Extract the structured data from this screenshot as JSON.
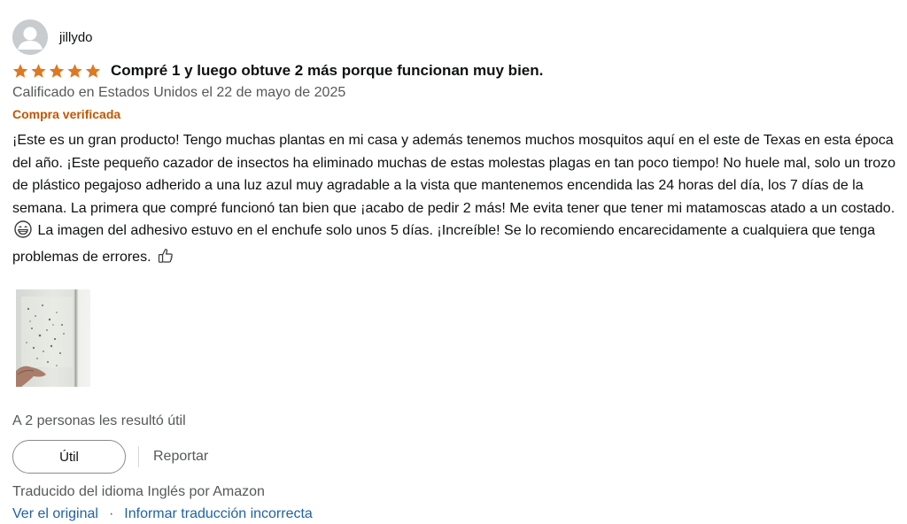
{
  "profile": {
    "name": "jillydo"
  },
  "review": {
    "rating": 5,
    "rating_max": 5,
    "title": "Compré 1 y luego obtuve 2 más porque funcionan muy bien.",
    "date": "Calificado en Estados Unidos el 22 de mayo de 2025",
    "verified": "Compra verificada",
    "body_part1": "¡Este es un gran producto! Tengo muchas plantas en mi casa y además tenemos muchos mosquitos aquí en el este de Texas en esta época del año. ¡Este pequeño cazador de insectos ha eliminado muchas de estas molestas plagas en tan poco tiempo! No huele mal, solo un trozo de plástico pegajoso adherido a una luz azul muy agradable a la vista que mantenemos encendida las 24 horas del día, los 7 días de la semana. La primera que compré funcionó tan bien que ¡acabo de pedir 2 más! Me evita tener que tener mi matamoscas atado a un costado.",
    "body_part2": "La imagen del adhesivo estuvo en el enchufe solo unos 5 días. ¡Increíble! Se lo recomiendo encarecidamente a cualquiera que tenga problemas de errores.",
    "emoji_1": "grinning-face-emoji",
    "emoji_2": "thumbs-up-emoji",
    "helpful_text": "A 2 personas les resultó útil"
  },
  "actions": {
    "useful_label": "Útil",
    "report_label": "Reportar"
  },
  "translation": {
    "note": "Traducido del idioma Inglés por Amazon",
    "see_original": "Ver el original",
    "separator": "·",
    "report_translation": "Informar traducción incorrecta"
  },
  "colors": {
    "star": "#de7921",
    "verified": "#c45500",
    "link": "#2162a1",
    "muted": "#565959",
    "text": "#0f1111"
  }
}
